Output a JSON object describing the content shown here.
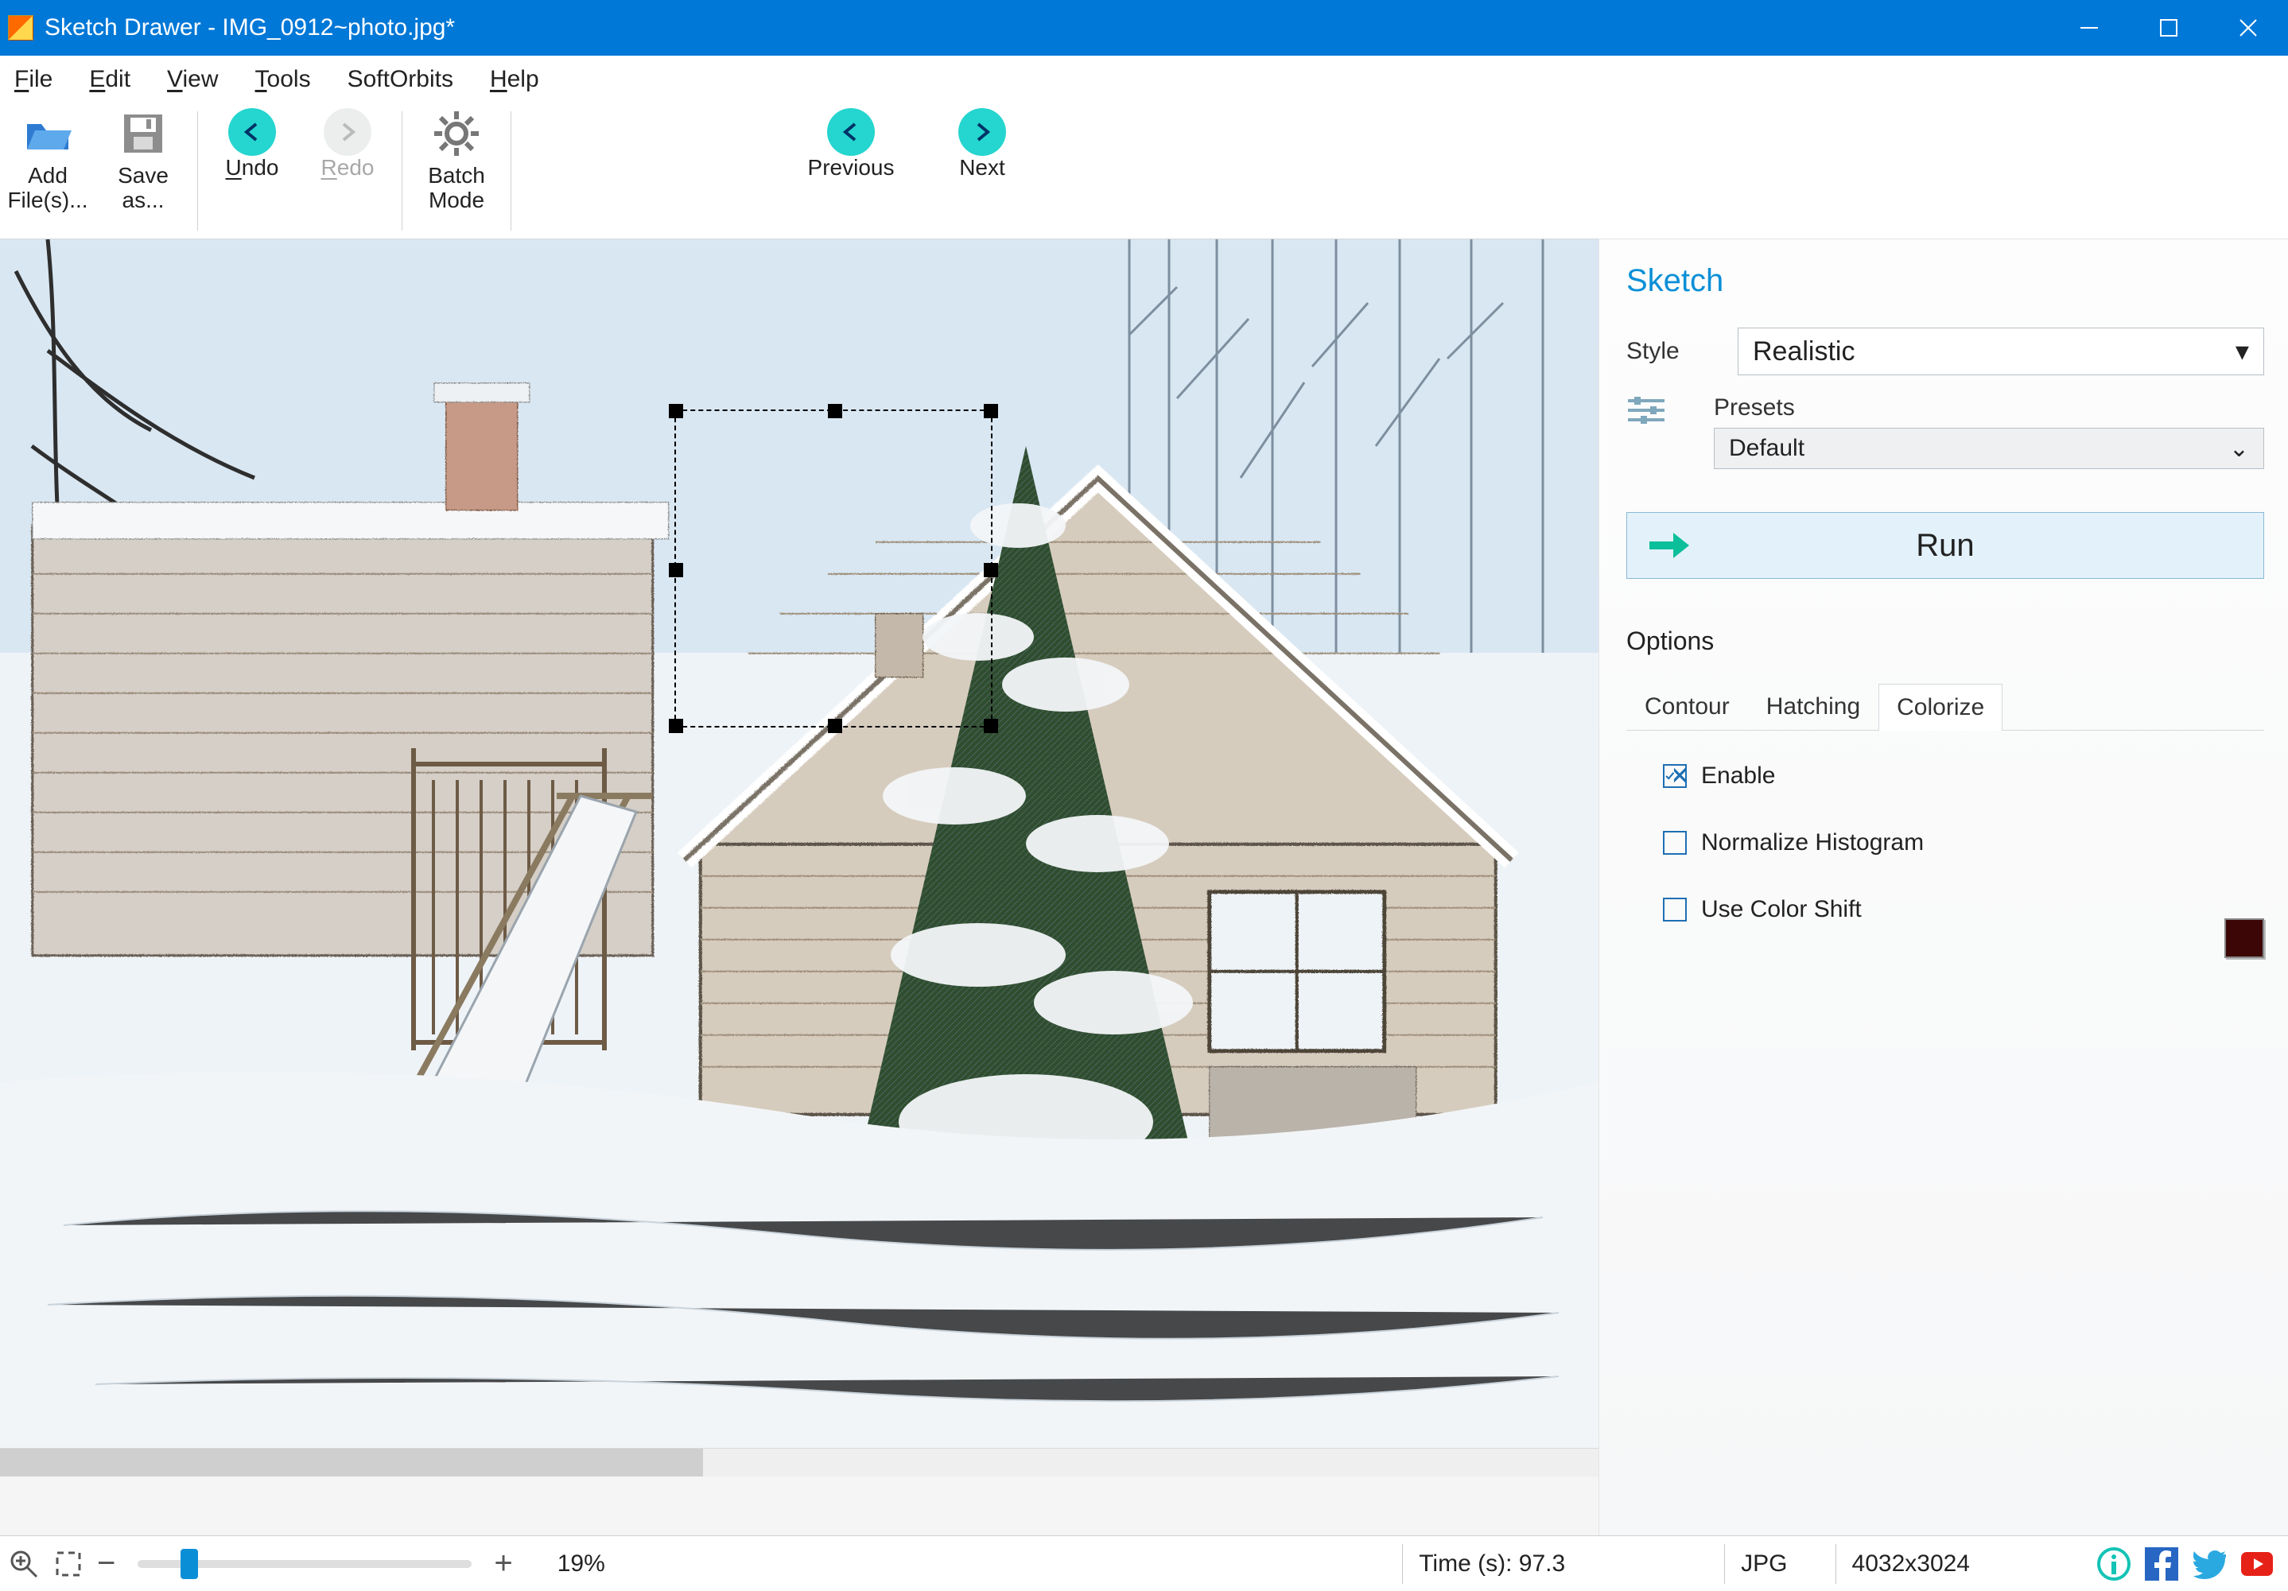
{
  "window": {
    "title": "Sketch Drawer - IMG_0912~photo.jpg*"
  },
  "menu": {
    "file": "File",
    "edit": "Edit",
    "view": "View",
    "tools": "Tools",
    "softorbits": "SoftOrbits",
    "help": "Help"
  },
  "toolbar": {
    "add": "Add\nFile(s)...",
    "save": "Save\nas...",
    "undo": "Undo",
    "redo": "Redo",
    "batch": "Batch\nMode",
    "prev": "Previous",
    "next": "Next"
  },
  "panel": {
    "heading": "Sketch",
    "style_label": "Style",
    "style_value": "Realistic",
    "presets_label": "Presets",
    "presets_value": "Default",
    "run_label": "Run",
    "options_label": "Options",
    "tabs": {
      "contour": "Contour",
      "hatching": "Hatching",
      "colorize": "Colorize"
    },
    "colorize": {
      "enable": "Enable",
      "normalize": "Normalize Histogram",
      "shift": "Use Color Shift",
      "color": "#3d0606"
    }
  },
  "status": {
    "zoom": "19%",
    "time": "Time (s): 97.3",
    "format": "JPG",
    "dims": "4032x3024"
  }
}
